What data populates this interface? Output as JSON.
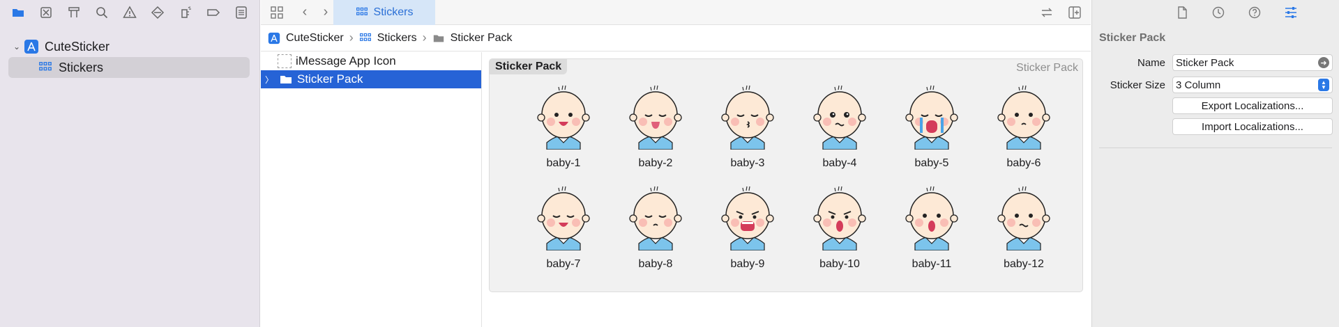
{
  "navigator": {
    "toolbar_icons": [
      "folder-icon",
      "source-control-icon",
      "symbol-icon",
      "find-icon",
      "issue-icon",
      "test-icon",
      "debug-icon",
      "breakpoint-icon",
      "report-icon"
    ],
    "tree": {
      "project": "CuteSticker",
      "group": "Stickers"
    }
  },
  "editor": {
    "tab": {
      "label": "Stickers"
    },
    "jumpbar": [
      "CuteSticker",
      "Stickers",
      "Sticker Pack"
    ],
    "assets": {
      "imessage_icon": "iMessage App Icon",
      "sticker_pack": "Sticker Pack"
    },
    "pack_panel": {
      "label": "Sticker Pack",
      "label_right": "Sticker Pack"
    },
    "stickers": [
      {
        "name": "baby-1",
        "mood": "happy"
      },
      {
        "name": "baby-2",
        "mood": "silly"
      },
      {
        "name": "baby-3",
        "mood": "kiss"
      },
      {
        "name": "baby-4",
        "mood": "teary"
      },
      {
        "name": "baby-5",
        "mood": "crying"
      },
      {
        "name": "baby-6",
        "mood": "confused"
      },
      {
        "name": "baby-7",
        "mood": "sleep-bubble"
      },
      {
        "name": "baby-8",
        "mood": "sleepy"
      },
      {
        "name": "baby-9",
        "mood": "angry"
      },
      {
        "name": "baby-10",
        "mood": "shout"
      },
      {
        "name": "baby-11",
        "mood": "surprised"
      },
      {
        "name": "baby-12",
        "mood": "sad"
      }
    ]
  },
  "inspector": {
    "tab_icons": [
      "file-inspector-icon",
      "history-inspector-icon",
      "help-inspector-icon",
      "attributes-inspector-icon"
    ],
    "title": "Sticker Pack",
    "name_label": "Name",
    "name_value": "Sticker Pack",
    "size_label": "Sticker Size",
    "size_value": "3 Column",
    "export_button": "Export Localizations...",
    "import_button": "Import Localizations..."
  },
  "colors": {
    "accent": "#2663d6",
    "tab_bg": "#d6e6f8",
    "navigator_bg": "#e8e4ec",
    "inspector_bg": "#ececec"
  }
}
